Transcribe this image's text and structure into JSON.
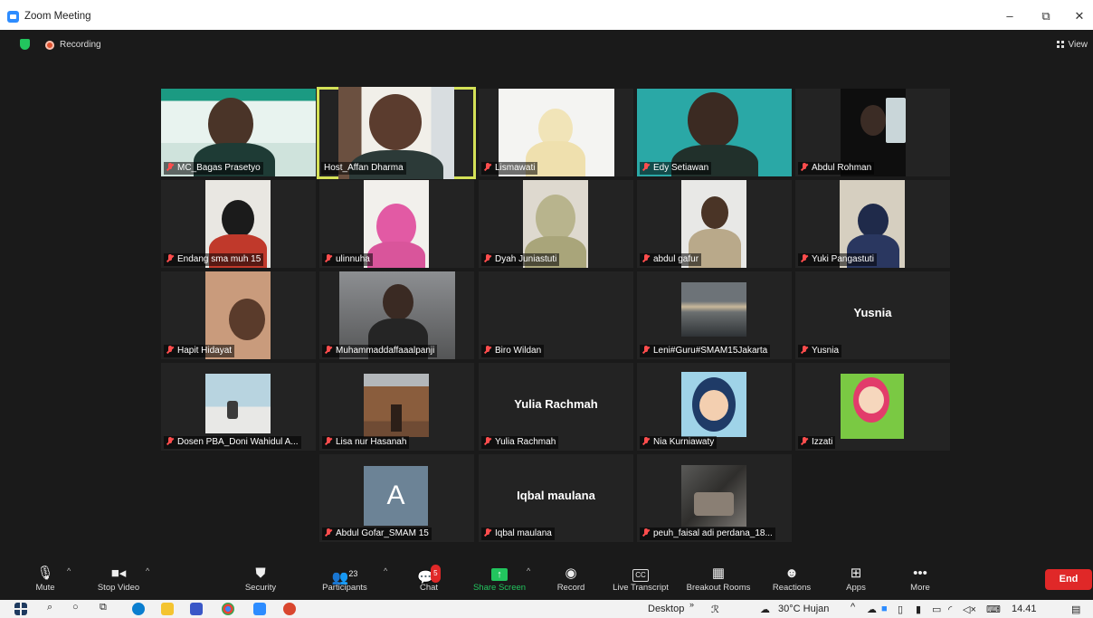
{
  "window": {
    "title": "Zoom Meeting",
    "minimize": "–",
    "maximize": "⧉",
    "close": "✕"
  },
  "top": {
    "recording": "Recording",
    "view": "View"
  },
  "participants": [
    {
      "name": "MC_Bagas Prasetyo",
      "active": false
    },
    {
      "name": "Host_Affan Dharma",
      "active": true
    },
    {
      "name": "Lismawati",
      "active": false
    },
    {
      "name": "Edy Setiawan",
      "active": false
    },
    {
      "name": "Abdul Rohman",
      "active": false
    },
    {
      "name": "Endang sma muh 15",
      "active": false
    },
    {
      "name": "ulinnuha",
      "active": false
    },
    {
      "name": "Dyah Juniastuti",
      "active": false
    },
    {
      "name": "abdul gafur",
      "active": false
    },
    {
      "name": "Yuki Pangastuti",
      "active": false
    },
    {
      "name": "Hapit Hidayat",
      "active": false
    },
    {
      "name": "Muhammaddaffaaalpanji",
      "active": false
    },
    {
      "name": "Biro Wildan",
      "active": false
    },
    {
      "name": "Leni#Guru#SMAM15Jakarta",
      "active": false
    },
    {
      "name": "Yusnia",
      "active": false,
      "display": "Yusnia"
    },
    {
      "name": "Dosen PBA_Doni Wahidul A...",
      "active": false
    },
    {
      "name": "Lisa nur Hasanah",
      "active": false
    },
    {
      "name": "Yulia Rachmah",
      "active": false,
      "display": "Yulia Rachmah"
    },
    {
      "name": "Nia Kurniawaty",
      "active": false
    },
    {
      "name": "Izzati",
      "active": false
    },
    {
      "name": "Abdul Gofar_SMAM 15",
      "active": false,
      "avatar": "A"
    },
    {
      "name": "Iqbal maulana",
      "active": false,
      "display": "Iqbal maulana"
    },
    {
      "name": "peuh_faisal adi perdana_18...",
      "active": false
    }
  ],
  "toolbar": {
    "mute": "Mute",
    "stop_video": "Stop Video",
    "security": "Security",
    "participants": "Participants",
    "participants_count": "23",
    "chat": "Chat",
    "chat_badge": "5",
    "share_screen": "Share Screen",
    "record": "Record",
    "live_transcript": "Live Transcript",
    "live_transcript_badge": "CC",
    "breakout_rooms": "Breakout Rooms",
    "reactions": "Reactions",
    "apps": "Apps",
    "more": "More",
    "end": "End"
  },
  "taskbar": {
    "desktop": "Desktop",
    "weather": "30°C  Hujan",
    "time": "14.41"
  },
  "colors": {
    "active_border": "#d4e157",
    "share_green": "#22c55e",
    "end_red": "#e02828"
  }
}
